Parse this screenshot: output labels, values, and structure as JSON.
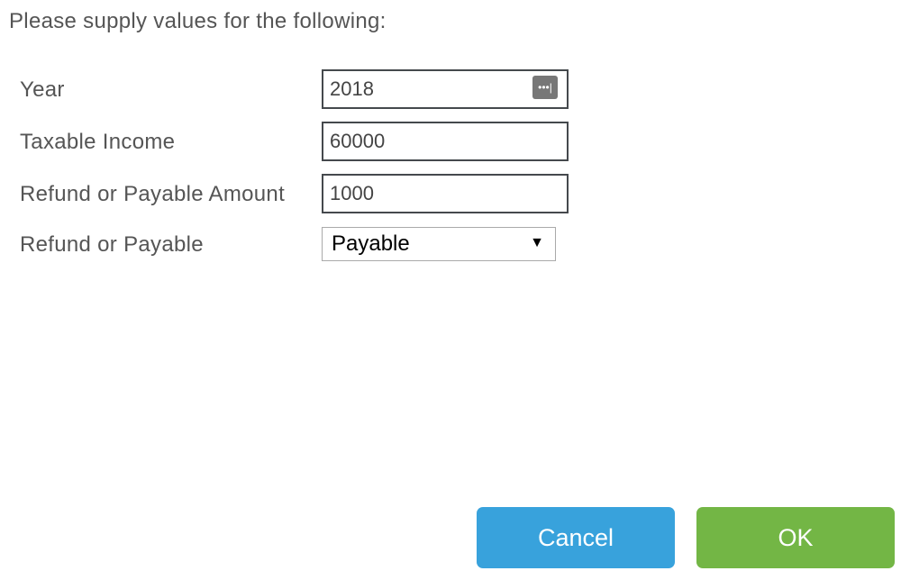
{
  "prompt": "Please supply values for the following:",
  "fields": [
    {
      "label": "Year",
      "value": "2018"
    },
    {
      "label": "Taxable Income",
      "value": "60000"
    },
    {
      "label": "Refund or Payable Amount",
      "value": "1000"
    }
  ],
  "select": {
    "label": "Refund or Payable",
    "value": "Payable",
    "arrow": "▼"
  },
  "picker_icon": "ellipsis-picker-icon",
  "buttons": {
    "cancel": {
      "label": "Cancel",
      "color": "#38a2dc"
    },
    "ok": {
      "label": "OK",
      "color": "#73b645"
    }
  }
}
